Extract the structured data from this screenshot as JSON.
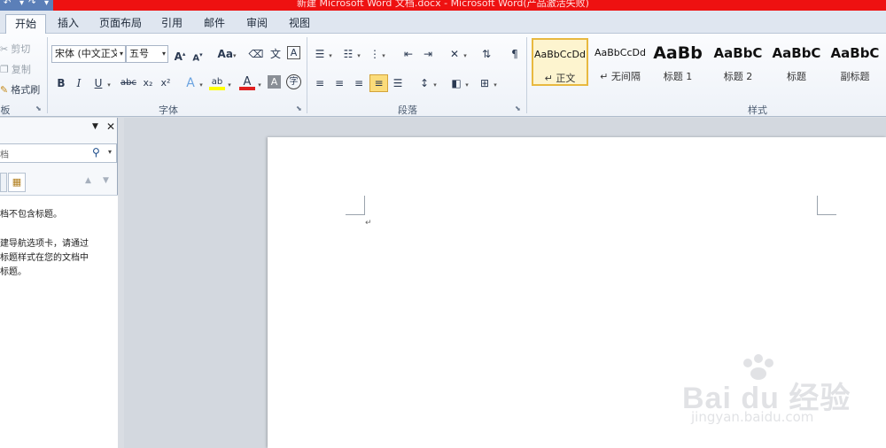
{
  "window": {
    "title": "新建 Microsoft Word 文档.docx - Microsoft Word(产品激活失败)"
  },
  "tabs": [
    {
      "label": "开始"
    },
    {
      "label": "插入"
    },
    {
      "label": "页面布局"
    },
    {
      "label": "引用"
    },
    {
      "label": "邮件"
    },
    {
      "label": "审阅"
    },
    {
      "label": "视图"
    }
  ],
  "clipboard": {
    "cut": "剪切",
    "copy": "复制",
    "format_painter": "格式刷",
    "group_label": "板"
  },
  "font": {
    "name": "宋体 (中文正文)",
    "size": "五号",
    "group_label": "字体",
    "grow": "A",
    "shrink": "A",
    "case": "Aa",
    "bold": "B",
    "italic": "I",
    "underline": "U",
    "strike": "abc",
    "subscript": "x₂",
    "superscript": "x²",
    "text_effect": "A",
    "highlight": "ab",
    "font_color": "A",
    "char_shading": "A",
    "enclose": "字"
  },
  "paragraph": {
    "group_label": "段落"
  },
  "styles": {
    "group_label": "样式",
    "items": [
      {
        "sample": "AaBbCcDd",
        "name": "↵ 正文"
      },
      {
        "sample": "AaBbCcDd",
        "name": "↵ 无间隔"
      },
      {
        "sample": "AaBb",
        "name": "标题 1"
      },
      {
        "sample": "AaBbC",
        "name": "标题 2"
      },
      {
        "sample": "AaBbC",
        "name": "标题"
      },
      {
        "sample": "AaBbC",
        "name": "副标题"
      }
    ]
  },
  "navigation": {
    "search_placeholder": "档",
    "message_line1": "档不包含标题。",
    "message_line2": "建导航选项卡，请通过",
    "message_line3": "标题样式在您的文档中",
    "message_line4": "标题。"
  },
  "document": {
    "paragraph_mark": "↵"
  },
  "watermark": {
    "main": "Bai du 经验",
    "sub": "jingyan.baidu.com"
  },
  "colors": {
    "titlebar": "#ee1111",
    "highlight": "#ffff00",
    "font_color": "#e02020",
    "selected_style": "#e8b940"
  }
}
